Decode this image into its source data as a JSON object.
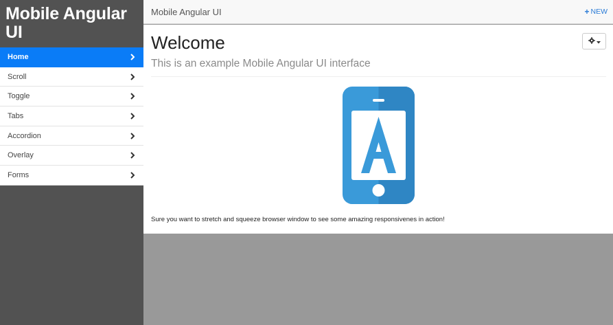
{
  "sidebar": {
    "brand": "Mobile Angular UI",
    "items": [
      {
        "label": "Home",
        "active": true
      },
      {
        "label": "Scroll"
      },
      {
        "label": "Toggle"
      },
      {
        "label": "Tabs"
      },
      {
        "label": "Accordion"
      },
      {
        "label": "Overlay"
      },
      {
        "label": "Forms"
      }
    ]
  },
  "topbar": {
    "title": "Mobile Angular UI",
    "new_label": "NEW"
  },
  "main": {
    "heading": "Welcome",
    "subtitle": "This is an example Mobile Angular UI interface",
    "note": "Sure you want to stretch and squeeze browser window to see some amazing responsivenes in action!",
    "logo_letter": "A"
  },
  "colors": {
    "sidebar_bg": "#525252",
    "active_item": "#0a7cf7",
    "accent": "#2a7bd6",
    "phone_light": "#3a9ad9",
    "phone_dark": "#2f86c4",
    "page_bg": "#999999"
  },
  "icons": {
    "menu_chevron": "chevron-right-icon",
    "new": "plus-icon",
    "settings": "gear-icon",
    "settings_caret": "caret-down-icon",
    "logo": "mobile-phone-icon"
  }
}
